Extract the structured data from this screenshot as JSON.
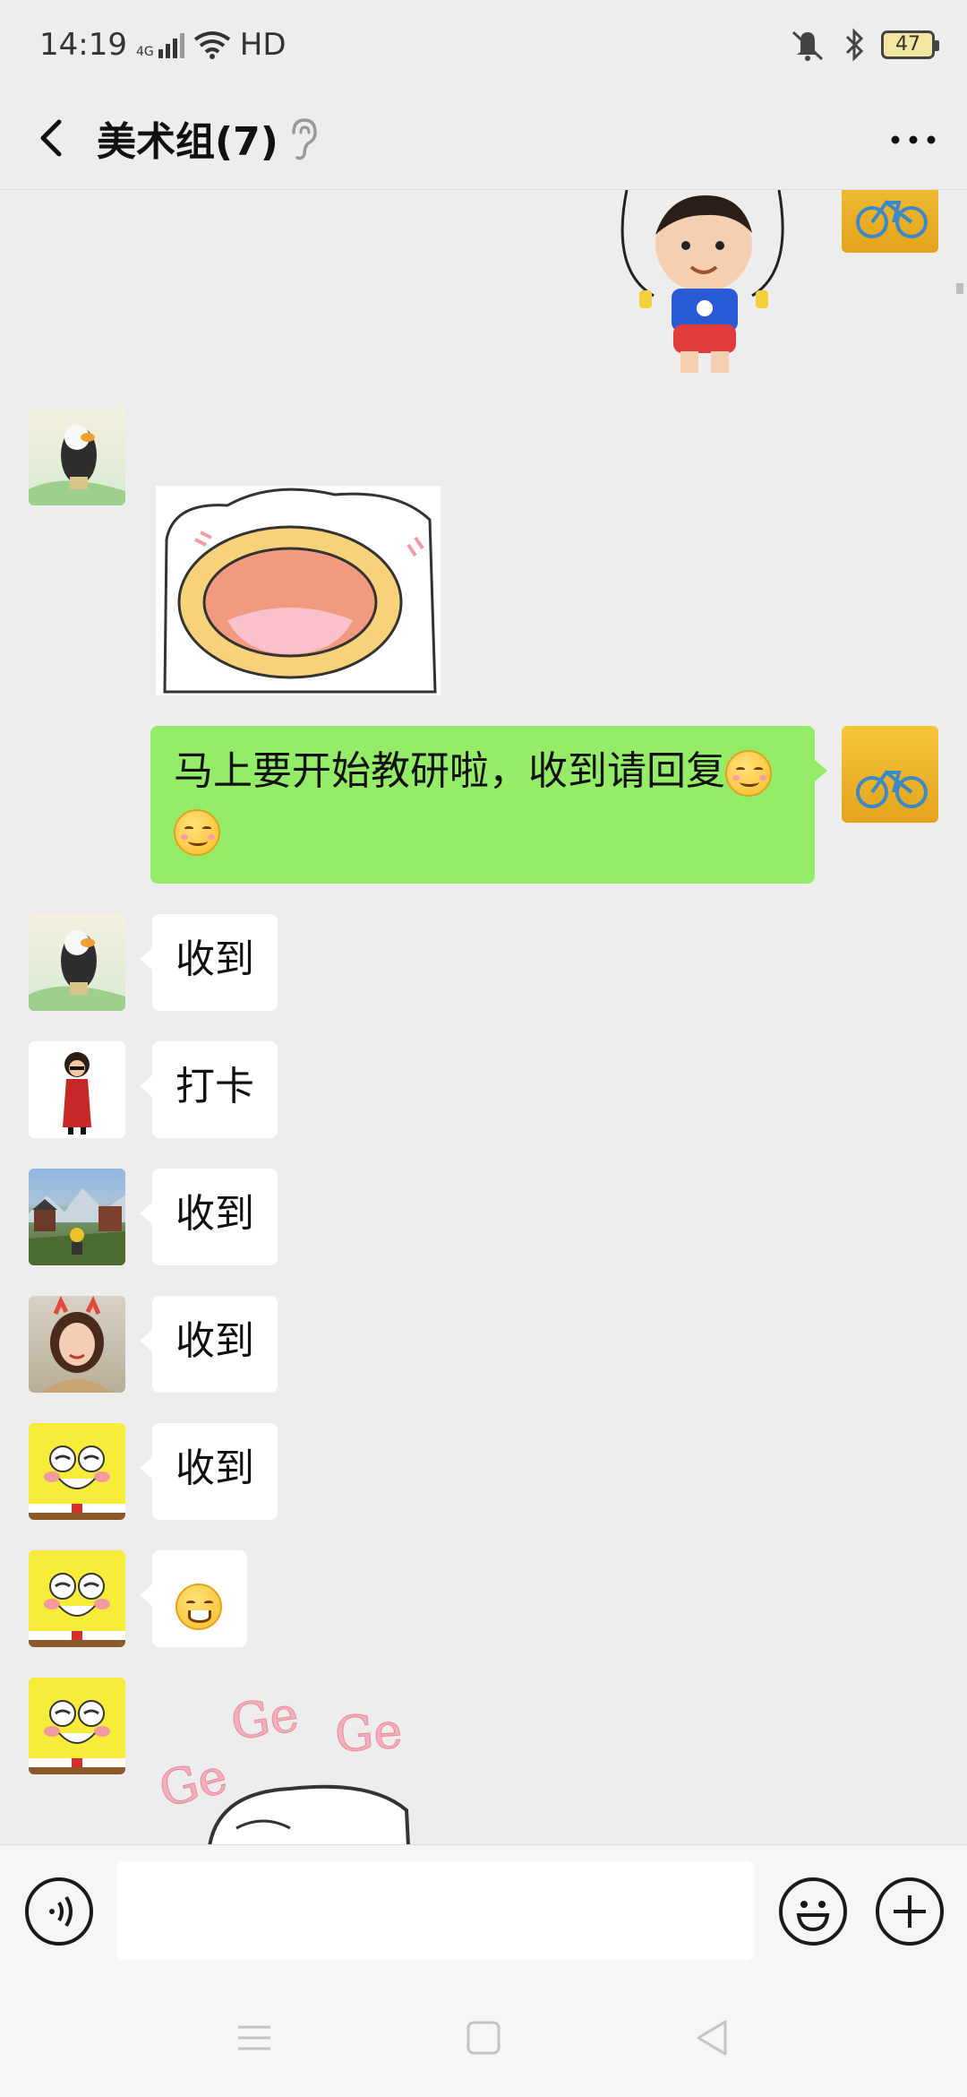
{
  "status_bar": {
    "time": "14:19",
    "network": "4G",
    "quality": "HD",
    "battery": "47"
  },
  "header": {
    "title": "美术组(7)"
  },
  "messages": {
    "outgoing_text": "马上要开始教研啦，收到请回复",
    "replies": [
      "收到",
      "打卡",
      "收到",
      "收到",
      "收到"
    ],
    "sticker_ge": [
      "Ge",
      "Ge",
      "Ge"
    ]
  },
  "icons": {
    "back": "chevron-left-icon",
    "ear": "ear-icon",
    "more": "more-dots-icon",
    "voice": "voice-icon",
    "emoji": "emoji-icon",
    "plus": "plus-icon"
  },
  "colors": {
    "outgoing_bubble": "#95ec69",
    "incoming_bubble": "#ffffff",
    "background": "#ededed"
  }
}
